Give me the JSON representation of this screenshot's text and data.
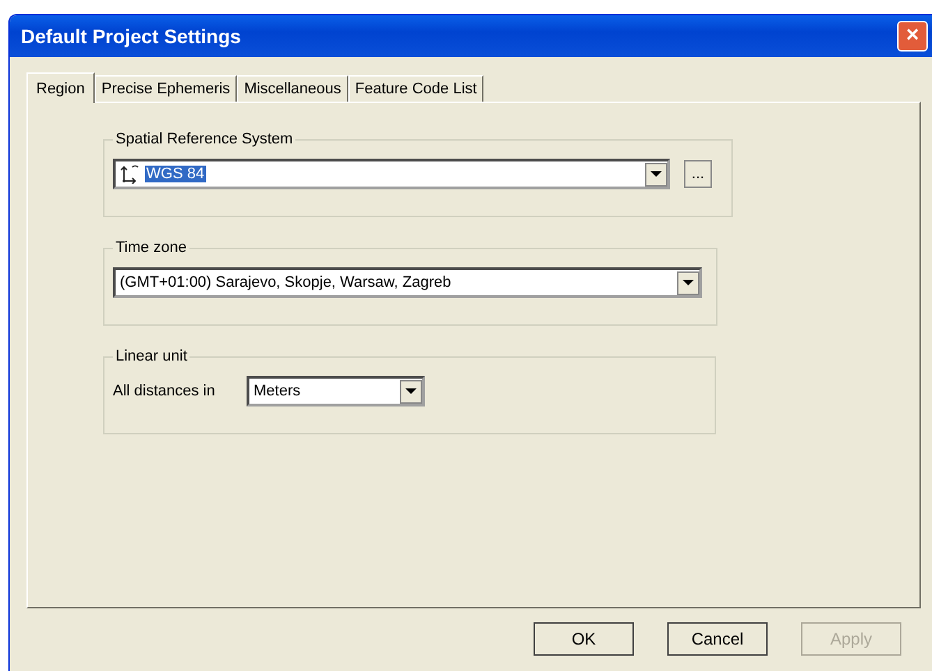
{
  "window": {
    "title": "Default Project Settings",
    "close": "×"
  },
  "tabs": [
    {
      "label": "Region",
      "selected": true
    },
    {
      "label": "Precise Ephemeris",
      "selected": false
    },
    {
      "label": "Miscellaneous",
      "selected": false
    },
    {
      "label": "Feature Code List",
      "selected": false
    }
  ],
  "spatial_reference": {
    "legend": "Spatial Reference System",
    "value": "WGS 84",
    "browse": "..."
  },
  "time_zone": {
    "legend": "Time zone",
    "value": "(GMT+01:00) Sarajevo, Skopje, Warsaw, Zagreb"
  },
  "linear_unit": {
    "legend": "Linear unit",
    "label": "All distances in",
    "value": "Meters"
  },
  "buttons": [
    {
      "label": "OK",
      "disabled": false
    },
    {
      "label": "Cancel",
      "disabled": false
    },
    {
      "label": "Apply",
      "disabled": true
    }
  ]
}
